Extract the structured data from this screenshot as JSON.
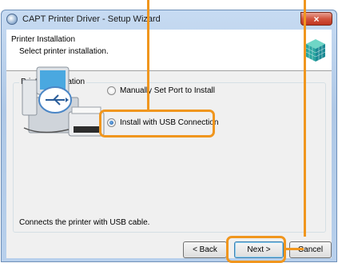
{
  "window": {
    "title": "CAPT Printer Driver - Setup Wizard",
    "close_label": "×"
  },
  "header": {
    "title": "Printer Installation",
    "subtitle": "Select printer installation."
  },
  "group": {
    "label": "Printer Installation",
    "options": [
      {
        "label": "Manually Set Port to Install",
        "selected": false
      },
      {
        "label": "Install with USB Connection",
        "selected": true
      }
    ]
  },
  "description": "Connects the printer with USB cable.",
  "buttons": {
    "back": "< Back",
    "next": "Next >",
    "cancel": "Cancel"
  },
  "colors": {
    "highlight": "#f0961e",
    "titlebar": "#b8d0ec"
  }
}
